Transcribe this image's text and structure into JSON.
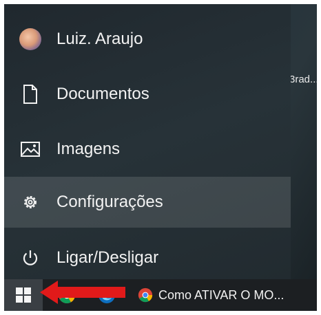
{
  "start_menu": {
    "items": [
      {
        "label": "Luiz. Araujo",
        "icon": "user-avatar"
      },
      {
        "label": "Documentos",
        "icon": "document-icon"
      },
      {
        "label": "Imagens",
        "icon": "image-icon"
      },
      {
        "label": "Configurações",
        "icon": "gear-icon"
      },
      {
        "label": "Ligar/Desligar",
        "icon": "power-icon"
      }
    ]
  },
  "desktop": {
    "text_fragment": "3rad..."
  },
  "taskbar": {
    "start_icon": "windows-logo-icon",
    "pinned_apps": [
      "chrome-icon",
      "edge-icon"
    ],
    "active_window_label": "Como ATIVAR O MO..."
  },
  "annotation": {
    "arrow_color": "#e11a1a"
  },
  "colors": {
    "menu_bg": "#252f35",
    "taskbar_bg": "#1c1f22",
    "highlight": "#3a4247"
  }
}
